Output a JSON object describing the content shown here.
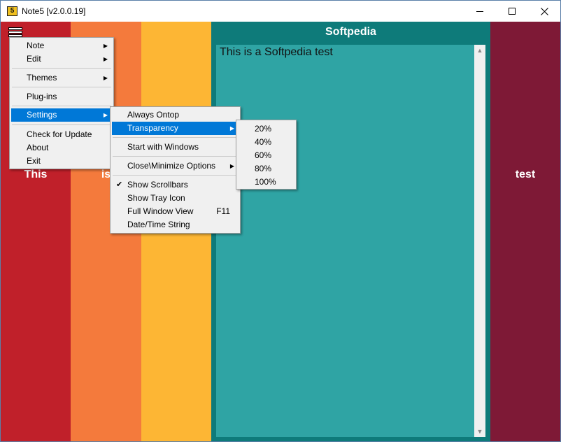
{
  "window": {
    "title": "Note5 [v2.0.0.19]",
    "icon_label": "5"
  },
  "columns": [
    {
      "label": "This",
      "color": "#c0202a"
    },
    {
      "label": "is",
      "color": "#f47a3c"
    },
    {
      "label": "",
      "color": "#fdb634"
    },
    {
      "title": "Softpedia",
      "color": "#0e7b7a"
    },
    {
      "label": "test",
      "color": "#7e1936"
    }
  ],
  "note": {
    "text": "This is a Softpedia test",
    "area_color": "#2fa4a4"
  },
  "main_menu": {
    "items": [
      {
        "label": "Note",
        "submenu": true
      },
      {
        "label": "Edit",
        "submenu": true
      },
      {
        "label": "Themes",
        "submenu": true
      },
      {
        "label": "Plug-ins"
      },
      {
        "label": "Settings",
        "submenu": true,
        "highlighted": true
      },
      {
        "label": "Check for Update"
      },
      {
        "label": "About"
      },
      {
        "label": "Exit"
      }
    ]
  },
  "settings_menu": {
    "items": [
      {
        "label": "Always Ontop"
      },
      {
        "label": "Transparency",
        "submenu": true,
        "highlighted": true
      },
      {
        "label": "Start with Windows"
      },
      {
        "label": "Close\\Minimize Options",
        "submenu": true
      },
      {
        "label": "Show Scrollbars",
        "checked": true
      },
      {
        "label": "Show Tray Icon"
      },
      {
        "label": "Full Window View",
        "shortcut": "F11"
      },
      {
        "label": "Date/Time String"
      }
    ]
  },
  "transparency_menu": {
    "items": [
      "20%",
      "40%",
      "60%",
      "80%",
      "100%"
    ]
  },
  "colors": {
    "highlight": "#0078d7",
    "menu_bg": "#f0f0f0"
  }
}
